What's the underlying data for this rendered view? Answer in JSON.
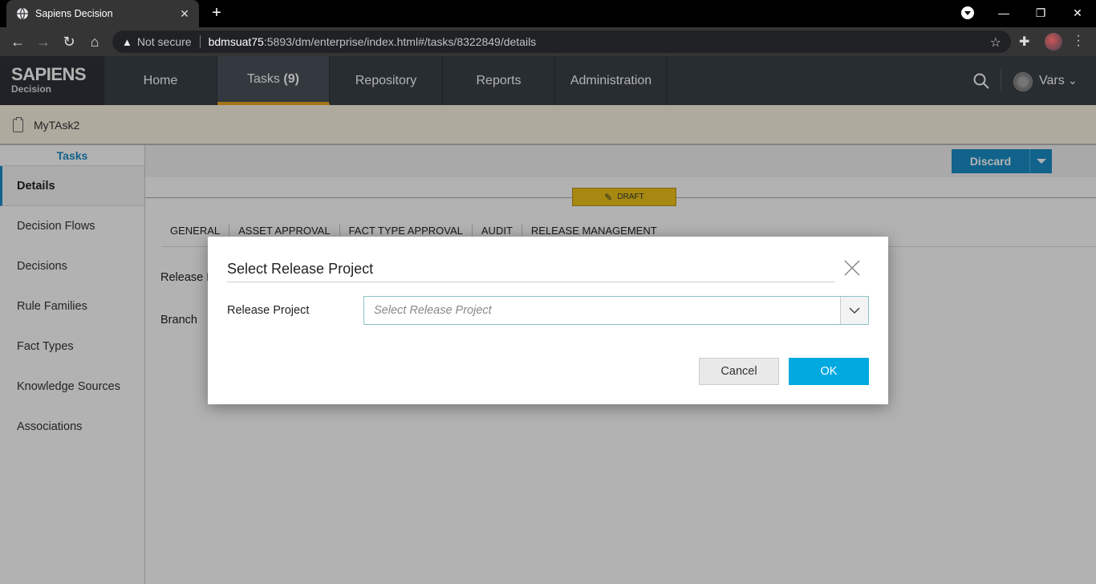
{
  "browser": {
    "tab_title": "Sapiens Decision",
    "not_secure": "Not secure",
    "url_host": "bdmsuat75",
    "url_rest": ":5893/dm/enterprise/index.html#/tasks/8322849/details"
  },
  "app": {
    "logo_line1": "SAPIENS",
    "logo_line2": "Decision",
    "nav": [
      {
        "label": "Home"
      },
      {
        "label": "Tasks",
        "count": "(9)"
      },
      {
        "label": "Repository"
      },
      {
        "label": "Reports"
      },
      {
        "label": "Administration"
      }
    ],
    "user_name": "Vars"
  },
  "task": {
    "name": "MyTAsk2"
  },
  "sidebar": {
    "header": "Tasks",
    "items": [
      {
        "label": "Details"
      },
      {
        "label": "Decision Flows"
      },
      {
        "label": "Decisions"
      },
      {
        "label": "Rule Families"
      },
      {
        "label": "Fact Types"
      },
      {
        "label": "Knowledge Sources"
      },
      {
        "label": "Associations"
      }
    ]
  },
  "content": {
    "discard_label": "Discard",
    "status": "DRAFT",
    "tabs": [
      "GENERAL",
      "ASSET APPROVAL",
      "FACT TYPE APPROVAL",
      "AUDIT",
      "RELEASE MANAGEMENT"
    ],
    "field_release": "Release P",
    "field_branch": "Branch"
  },
  "modal": {
    "title": "Select Release Project",
    "field_label": "Release Project",
    "placeholder": "Select Release Project",
    "cancel_label": "Cancel",
    "ok_label": "OK"
  },
  "colors": {
    "accent_blue": "#1a8fc9",
    "ok_blue": "#00a9e0",
    "nav_active_underline": "#f0a821",
    "draft_badge": "#f0c419",
    "header_bg": "#3a4147"
  }
}
